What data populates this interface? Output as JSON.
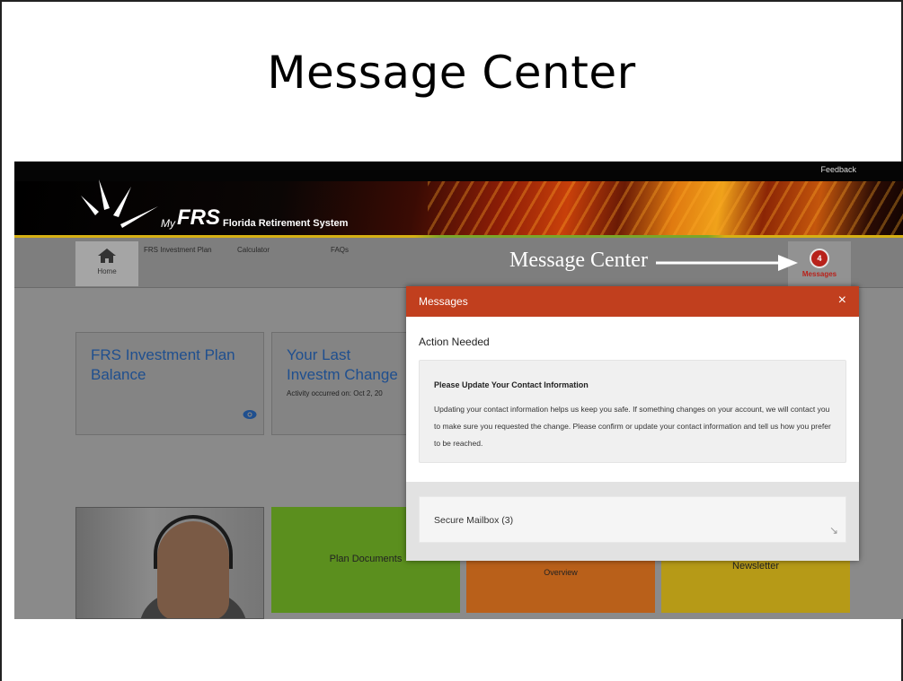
{
  "slide": {
    "title": "Message Center"
  },
  "site": {
    "feedback": "Feedback",
    "logo_my": "My",
    "logo_frs": "FRS",
    "logo_sub": "Florida Retirement System",
    "nav": {
      "home": "Home",
      "investment_plan": "FRS Investment Plan",
      "calculator": "Calculator",
      "faqs": "FAQs",
      "messages_label": "Messages",
      "messages_count": "4"
    }
  },
  "annotation": {
    "text": "Message Center"
  },
  "cards": {
    "balance_title": "FRS Investment Plan Balance",
    "last_change_title": "Your Last Investm Change",
    "last_change_sub": "Activity occurred on: Oct 2, 20"
  },
  "tiles": {
    "plan_documents": "Plan Documents",
    "overview": "Overview",
    "newsletter": "Newsletter"
  },
  "modal": {
    "title": "Messages",
    "close": "×",
    "section_title": "Action Needed",
    "notice_heading": "Please Update Your Contact Information",
    "notice_body": "Updating your contact information helps us keep you safe. If something changes on your account, we will contact you to make sure you requested the change. Please confirm or update your contact information and tell us how you prefer to be reached.",
    "mailbox_label": "Secure Mailbox (3)",
    "mailbox_arrow": "↘"
  },
  "colors": {
    "modal_header": "#c13f1e",
    "badge": "#b8221b",
    "tile_green": "#5b8f1e",
    "tile_orange": "#b9601a",
    "tile_yellow": "#b69a17"
  }
}
